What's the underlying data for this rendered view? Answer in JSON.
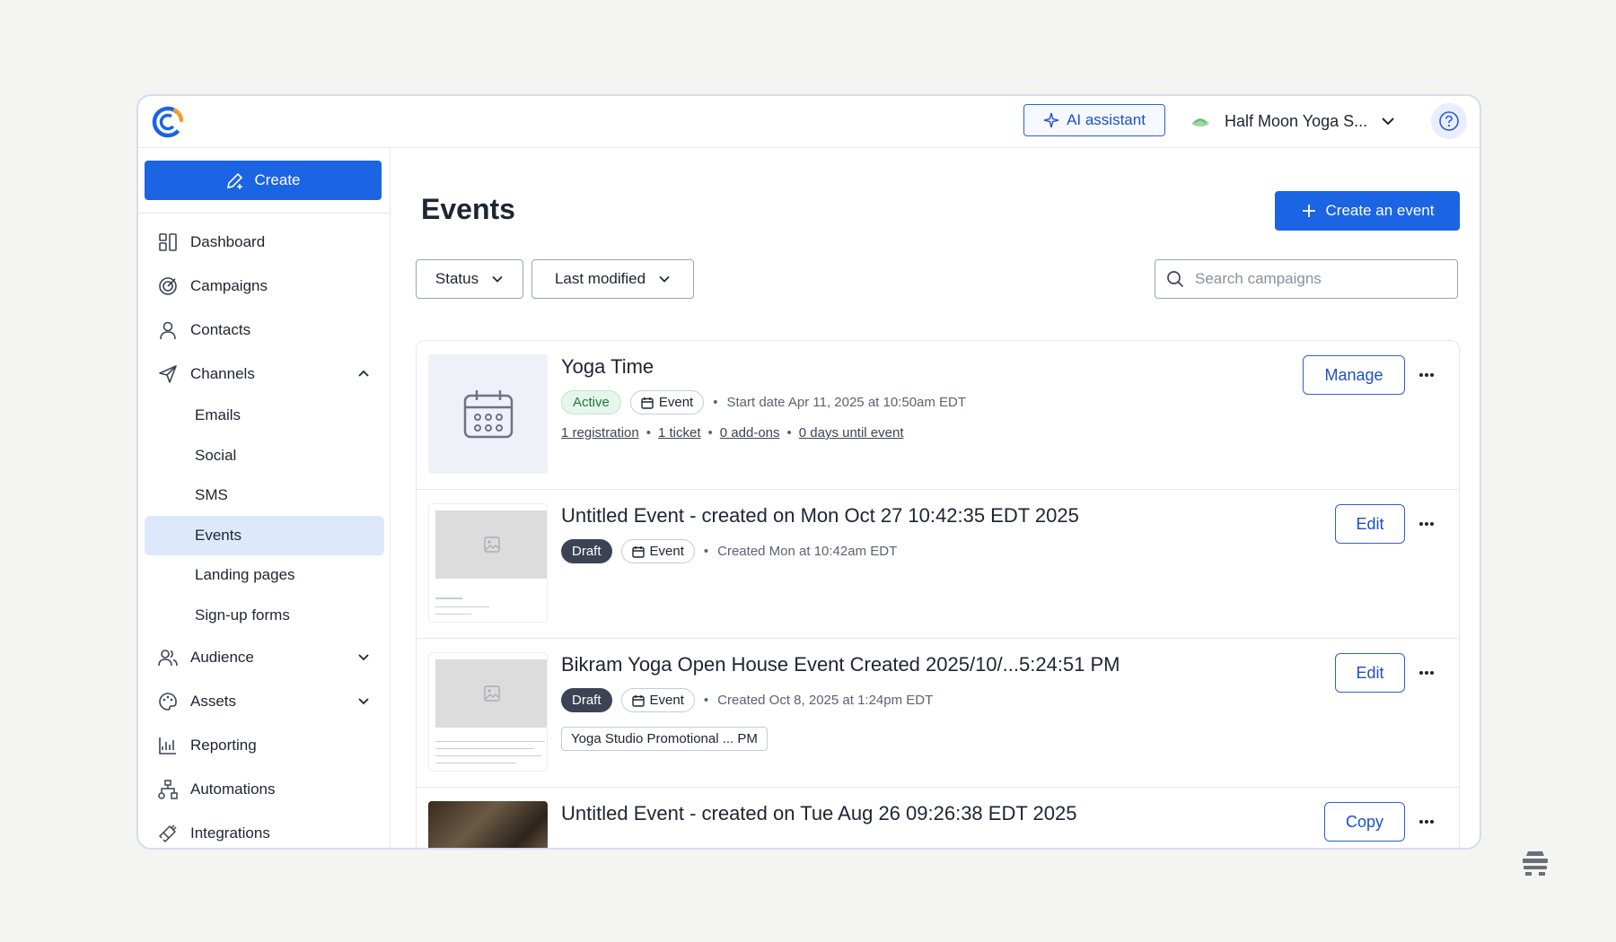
{
  "topbar": {
    "ai_assistant_label": "AI assistant",
    "account_name": "Half Moon Yoga S..."
  },
  "sidebar": {
    "create_label": "Create",
    "items": [
      {
        "label": "Dashboard"
      },
      {
        "label": "Campaigns"
      },
      {
        "label": "Contacts"
      },
      {
        "label": "Channels"
      }
    ],
    "channels_sub": [
      {
        "label": "Emails"
      },
      {
        "label": "Social"
      },
      {
        "label": "SMS"
      },
      {
        "label": "Events"
      },
      {
        "label": "Landing pages"
      },
      {
        "label": "Sign-up forms"
      }
    ],
    "items_after": [
      {
        "label": "Audience"
      },
      {
        "label": "Assets"
      },
      {
        "label": "Reporting"
      },
      {
        "label": "Automations"
      },
      {
        "label": "Integrations"
      }
    ]
  },
  "main": {
    "title": "Events",
    "create_event_label": "Create an event",
    "filters": {
      "status": "Status",
      "last_modified": "Last modified"
    },
    "search_placeholder": "Search campaigns"
  },
  "events": [
    {
      "title": "Yoga Time",
      "status": "Active",
      "type": "Event",
      "meta": "Start date Apr 11, 2025 at 10:50am EDT",
      "links": [
        "1 registration",
        "1 ticket",
        "0 add-ons",
        "0 days until event"
      ],
      "action": "Manage"
    },
    {
      "title": "Untitled Event - created on Mon Oct 27 10:42:35 EDT 2025",
      "status": "Draft",
      "type": "Event",
      "meta": "Created Mon at 10:42am EDT",
      "action": "Edit"
    },
    {
      "title": "Bikram Yoga Open House Event Created 2025/10/...5:24:51 PM",
      "status": "Draft",
      "type": "Event",
      "meta": "Created Oct 8, 2025 at 1:24pm EDT",
      "tag": "Yoga Studio Promotional ... PM",
      "action": "Edit"
    },
    {
      "title": "Untitled Event - created on Tue Aug 26 09:26:38 EDT 2025",
      "action": "Copy"
    }
  ],
  "colors": {
    "primary": "#1b64e3",
    "active_nav": "#dde9fb",
    "draft_badge": "#3b4354",
    "active_badge": "#e6f6ec"
  }
}
